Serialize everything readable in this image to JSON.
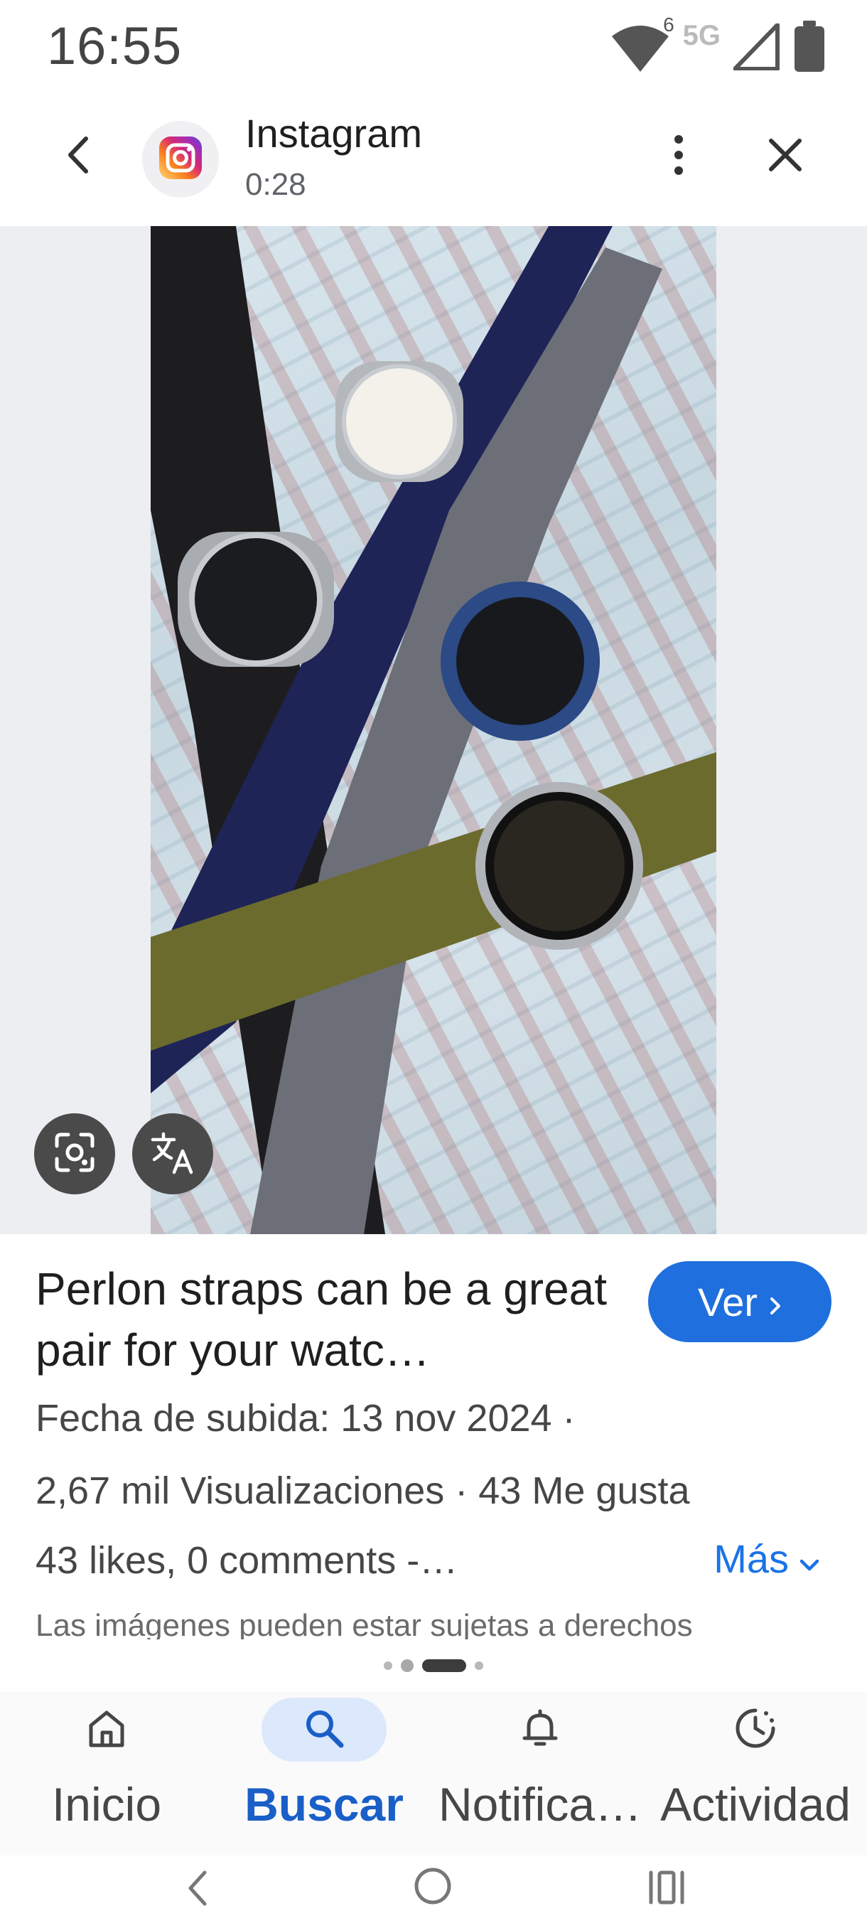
{
  "status_bar": {
    "time": "16:55",
    "wifi_badge": "6",
    "network": "5G",
    "icons": [
      "wifi-icon",
      "signal-icon",
      "battery-icon"
    ]
  },
  "header": {
    "back_icon": "chevron-left-icon",
    "app_icon": "instagram-logo",
    "title": "Instagram",
    "subtitle": "0:28",
    "more_icon": "more-vertical-icon",
    "close_icon": "close-icon"
  },
  "image_overlay": {
    "lens_icon": "google-lens-icon",
    "translate_icon": "translate-icon"
  },
  "result": {
    "title": "Perlon straps can be a great pair for your watc…",
    "view_button": "Ver",
    "upload_date": "Fecha de subida: 13 nov 2024 ·",
    "stats": "2,67 mil Visualizaciones · 43 Me gusta",
    "description": "43 likes, 0 comments -…",
    "more_label": "Más",
    "disclaimer": "Las imágenes pueden estar sujetas a derechos"
  },
  "bottom_nav": {
    "items": [
      {
        "label": "Inicio",
        "icon": "home-icon",
        "active": false
      },
      {
        "label": "Buscar",
        "icon": "search-icon",
        "active": true
      },
      {
        "label": "Notifica…",
        "icon": "bell-icon",
        "active": false
      },
      {
        "label": "Actividad",
        "icon": "activity-icon",
        "active": false
      }
    ]
  },
  "colors": {
    "accent": "#1a73e8",
    "button": "#1f6fde",
    "active_pill": "#dce8fb"
  }
}
